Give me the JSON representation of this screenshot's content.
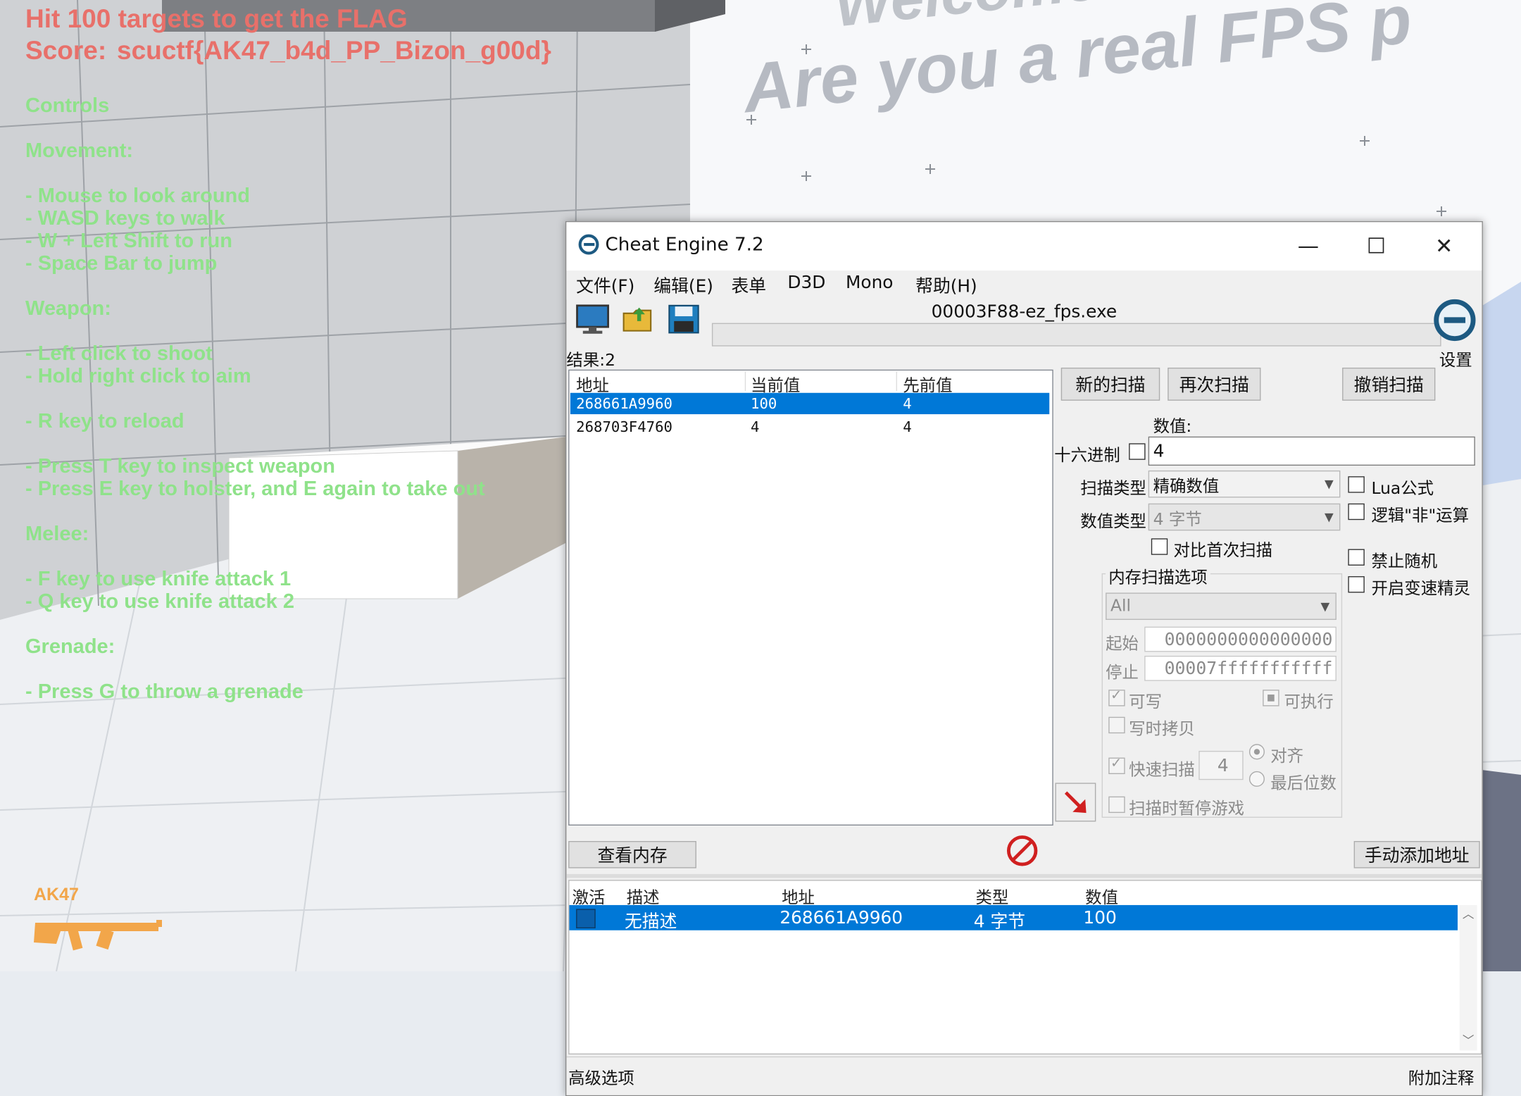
{
  "hud": {
    "objective": "Hit 100 targets to get the FLAG",
    "score_label": "Score:",
    "score_value": "scuctf{AK47_b4d_PP_Bizon_g00d}",
    "controls_heading": "Controls",
    "movement_heading": "Movement:",
    "movement": [
      "- Mouse to look around",
      "- WASD keys to walk",
      "- W + Left Shift to run",
      "- Space Bar to jump"
    ],
    "weapon_heading": "Weapon:",
    "weapon_lines": [
      "- Left click to shoot",
      "- Hold right click to aim"
    ],
    "reload": "- R key to reload",
    "inspect_lines": [
      "- Press T key to inspect weapon",
      "- Press E key to holster, and E again to take out"
    ],
    "melee_heading": "Melee:",
    "melee": [
      "- F key to use knife attack 1",
      "- Q key to use knife attack 2"
    ],
    "grenade_heading": "Grenade:",
    "grenade": "- Press G to throw a grenade",
    "weapon_name": "AK47",
    "wall_text_top": "Welcome",
    "wall_text_main": "Are you a real FPS p"
  },
  "ce": {
    "title": "Cheat Engine 7.2",
    "window_buttons": {
      "minimize": "—",
      "maximize": "☐",
      "close": "✕"
    },
    "menu": [
      "文件(F)",
      "编辑(E)",
      "表单",
      "D3D",
      "Mono",
      "帮助(H)"
    ],
    "process": "00003F88-ez_fps.exe",
    "settings_label": "设置",
    "results_label": "结果:2",
    "found_headers": [
      "地址",
      "当前值",
      "先前值"
    ],
    "found_rows": [
      {
        "address": "268661A9960",
        "current": "100",
        "previous": "4"
      },
      {
        "address": "268703F4760",
        "current": "4",
        "previous": "4"
      }
    ],
    "new_scan": "新的扫描",
    "next_scan": "再次扫描",
    "undo_scan": "撤销扫描",
    "value_label": "数值:",
    "value": "4",
    "hex_label": "十六进制",
    "scan_type_label": "扫描类型",
    "scan_type": "精确数值",
    "value_type_label": "数值类型",
    "value_type": "4 字节",
    "compare_first": "对比首次扫描",
    "lua_formula": "Lua公式",
    "logic_not": "逻辑\"非\"运算",
    "no_random": "禁止随机",
    "speedhack": "开启变速精灵",
    "mem_options_title": "内存扫描选项",
    "mem_region": "All",
    "start_label": "起始",
    "start_value": "0000000000000000",
    "stop_label": "停止",
    "stop_value": "00007fffffffffff",
    "writable": "可写",
    "executable": "可执行",
    "copy_on_write": "写时拷贝",
    "fast_scan": "快速扫描",
    "fast_scan_value": "4",
    "align": "对齐",
    "last_digits": "最后位数",
    "pause_game": "扫描时暂停游戏",
    "view_memory": "查看内存",
    "add_address": "手动添加地址",
    "table_headers": [
      "激活",
      "描述",
      "地址",
      "类型",
      "数值"
    ],
    "table_rows": [
      {
        "description": "无描述",
        "address": "268661A9960",
        "type": "4 字节",
        "value": "100"
      }
    ],
    "advanced": "高级选项",
    "comments": "附加注释"
  }
}
